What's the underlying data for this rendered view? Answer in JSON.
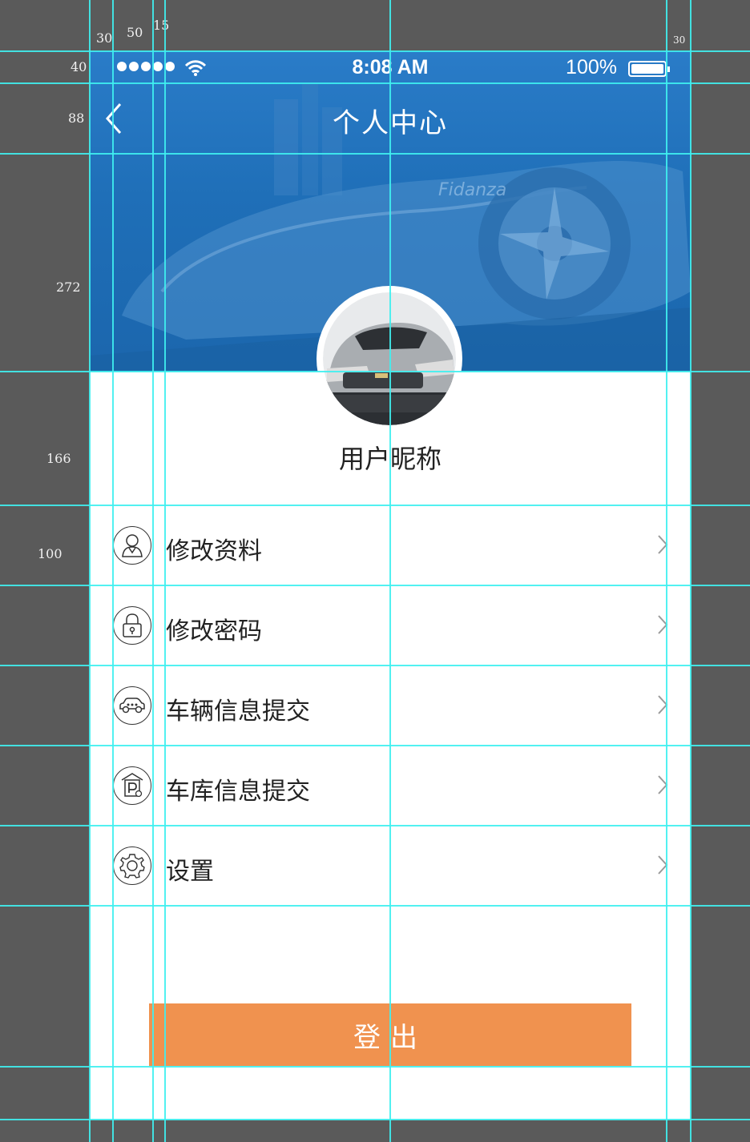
{
  "annotations": {
    "top_30": "30",
    "top_50": "50",
    "top_15": "15",
    "top_right_30": "30",
    "left_40": "40",
    "left_88": "88",
    "left_272": "272",
    "left_166": "166",
    "left_100": "100"
  },
  "status_bar": {
    "time": "8:08 AM",
    "battery": "100%"
  },
  "nav": {
    "title": "个人中心"
  },
  "profile": {
    "nickname": "用户昵称"
  },
  "menu": [
    {
      "label": "修改资料",
      "icon": "user-icon"
    },
    {
      "label": "修改密码",
      "icon": "lock-icon"
    },
    {
      "label": "车辆信息提交",
      "icon": "car-icon"
    },
    {
      "label": "车库信息提交",
      "icon": "parking-icon"
    },
    {
      "label": "设置",
      "icon": "gear-icon"
    }
  ],
  "logout": {
    "label": "登出"
  },
  "colors": {
    "header_blue": "#2a7cc8",
    "logout_orange": "#f0924f",
    "guide_cyan": "#3ff0f0",
    "canvas_gray": "#5a5a5a"
  }
}
